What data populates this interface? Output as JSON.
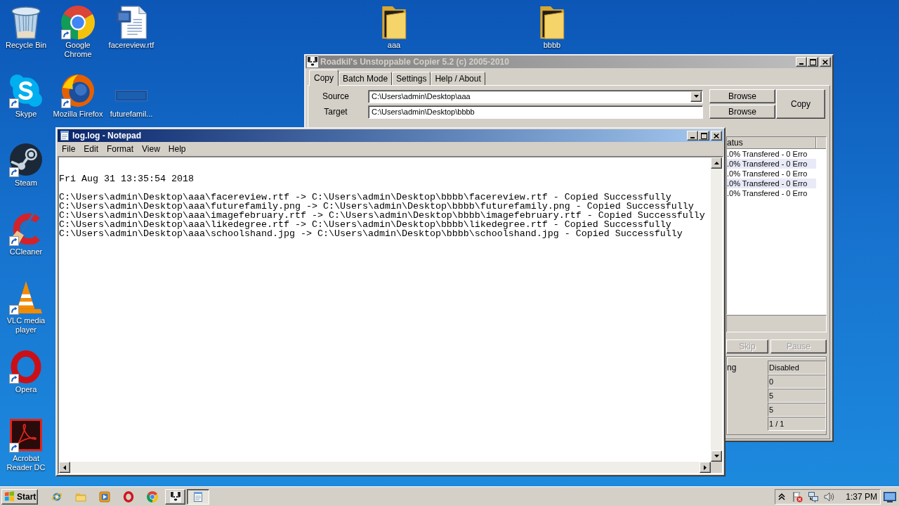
{
  "desktop": {
    "icons": [
      {
        "label": "Recycle Bin",
        "shortcut": false
      },
      {
        "label": "Google Chrome",
        "shortcut": true
      },
      {
        "label": "facereview.rtf",
        "shortcut": false
      },
      {
        "label": "aaa",
        "shortcut": false
      },
      {
        "label": "bbbb",
        "shortcut": false
      },
      {
        "label": "Skype",
        "shortcut": true
      },
      {
        "label": "Mozilla Firefox",
        "shortcut": true
      },
      {
        "label": "futurefamil...",
        "shortcut": false
      },
      {
        "label": "Steam",
        "shortcut": true
      },
      {
        "label": "CCleaner",
        "shortcut": true
      },
      {
        "label": "VLC media player",
        "shortcut": true
      },
      {
        "label": "Opera",
        "shortcut": true
      },
      {
        "label": "Acrobat Reader DC",
        "shortcut": true
      }
    ]
  },
  "copier_window": {
    "title": "Roadkil's Unstoppable Copier 5.2 (c) 2005-2010",
    "active": false,
    "tabs": [
      {
        "label": "Copy",
        "selected": true
      },
      {
        "label": "Batch Mode",
        "selected": false
      },
      {
        "label": "Settings",
        "selected": false
      },
      {
        "label": "Help / About",
        "selected": false
      }
    ],
    "source": {
      "label": "Source",
      "value": "C:\\Users\\admin\\Desktop\\aaa"
    },
    "target": {
      "label": "Target",
      "value": "C:\\Users\\admin\\Desktop\\bbbb"
    },
    "browse_buttons": [
      "Browse",
      "Browse"
    ],
    "copy_button": "Copy",
    "file_list": {
      "column_header": "atus",
      "rows": [
        ".0% Transfered - 0 Erro",
        ".0% Transfered - 0 Erro",
        ".0% Transfered - 0 Erro",
        ".0% Transfered - 0 Erro",
        ".0% Transfered - 0 Erro"
      ]
    },
    "action_buttons": [
      {
        "label": "Skip",
        "disabled": true
      },
      {
        "label": "Pause",
        "disabled": true
      }
    ],
    "options": {
      "label": "ng",
      "values": [
        "Disabled",
        "0",
        "5",
        "5",
        "1 / 1"
      ]
    }
  },
  "notepad_window": {
    "title": "log.log - Notepad",
    "active": true,
    "menu": [
      "File",
      "Edit",
      "Format",
      "View",
      "Help"
    ],
    "date_line": "Fri Aug 31 13:35:54 2018",
    "entries": [
      "C:\\Users\\admin\\Desktop\\aaa\\facereview.rtf -> C:\\Users\\admin\\Desktop\\bbbb\\facereview.rtf - Copied Successfully",
      "C:\\Users\\admin\\Desktop\\aaa\\futurefamily.png -> C:\\Users\\admin\\Desktop\\bbbb\\futurefamily.png - Copied Successfully",
      "C:\\Users\\admin\\Desktop\\aaa\\imagefebruary.rtf -> C:\\Users\\admin\\Desktop\\bbbb\\imagefebruary.rtf - Copied Successfully",
      "C:\\Users\\admin\\Desktop\\aaa\\likedegree.rtf -> C:\\Users\\admin\\Desktop\\bbbb\\likedegree.rtf - Copied Successfully",
      "C:\\Users\\admin\\Desktop\\aaa\\schoolshand.jpg -> C:\\Users\\admin\\Desktop\\bbbb\\schoolshand.jpg - Copied Successfully"
    ]
  },
  "taskbar": {
    "start_button": "Start",
    "tasks": [
      {
        "selected": false
      },
      {
        "selected": true
      }
    ],
    "clock": "1:37 PM"
  }
}
